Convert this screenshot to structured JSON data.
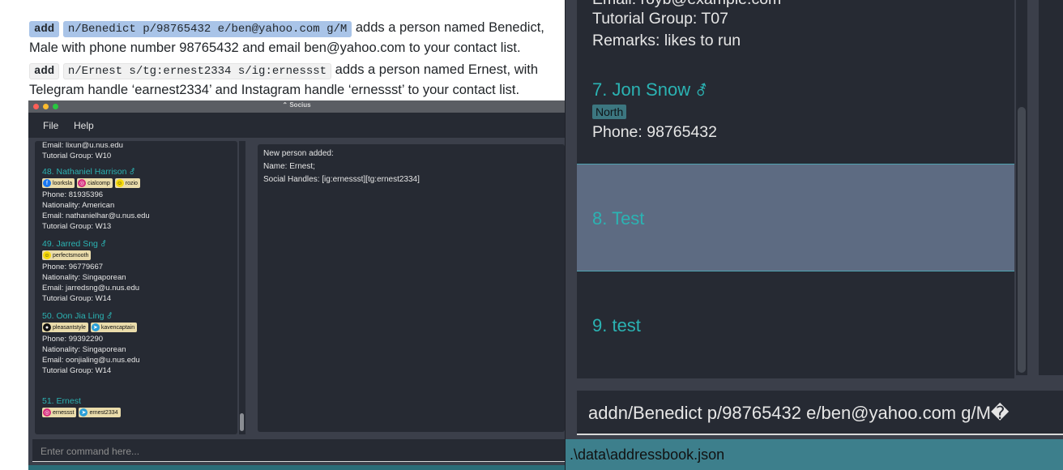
{
  "doc": {
    "item1": {
      "code_prefix": "add",
      "code_args": "n/Benedict p/98765432 e/ben@yahoo.com g/M",
      "line1": "adds a person named Benedict,",
      "line2": "Male with phone number 98765432 and email ben@yahoo.com to your contact list."
    },
    "item2": {
      "code_prefix": "add",
      "code_args": "n/Ernest s/tg:ernest2334 s/ig:ernessst",
      "line1": "adds a person named Ernest, with",
      "line2": "Telegram handle ‘earnest2334’ and Instagram handle ‘ernessst’ to your contact list."
    }
  },
  "small_window": {
    "title": "Socius",
    "menu": [
      "File",
      "Help"
    ],
    "list": {
      "top_email": "Email: lixun@u.nus.edu",
      "top_group": "Tutorial Group: W10",
      "persons": [
        {
          "name": "48.  Nathaniel Harrison",
          "tags": [
            {
              "icon": "facebook-icon",
              "label": "loorksla",
              "color": "#1877f2"
            },
            {
              "icon": "instagram-icon",
              "label": "cialcomp",
              "color": "#d6297b"
            },
            {
              "icon": "snapchat-icon",
              "label": "rozio",
              "color": "#f5d90a"
            }
          ],
          "phone": "Phone: 81935396",
          "nationality": "Nationality: American",
          "email": "Email: nathanielhar@u.nus.edu",
          "group": "Tutorial Group: W13"
        },
        {
          "name": "49.  Jarred Sng",
          "tags": [
            {
              "icon": "snapchat-icon",
              "label": "perfectsmooth",
              "color": "#f5d90a"
            }
          ],
          "phone": "Phone: 96779667",
          "nationality": "Nationality: Singaporean",
          "email": "Email: jarredsng@u.nus.edu",
          "group": "Tutorial Group: W14"
        },
        {
          "name": "50.  Oon Jia Ling",
          "tags": [
            {
              "icon": "github-icon",
              "label": "pleasantstyle",
              "color": "#111111"
            },
            {
              "icon": "telegram-icon",
              "label": "kavencaptain",
              "color": "#2a9fd8"
            }
          ],
          "phone": "Phone: 99392290",
          "nationality": "Nationality: Singaporean",
          "email": "Email: oonjialing@u.nus.edu",
          "group": "Tutorial Group: W14"
        },
        {
          "name": "51.  Ernest",
          "tags": [
            {
              "icon": "instagram-icon",
              "label": "ernessst",
              "color": "#d6297b"
            },
            {
              "icon": "telegram-icon",
              "label": "ernest2334",
              "color": "#2a9fd8"
            }
          ]
        }
      ]
    },
    "result": [
      "New person added:",
      "Name: Ernest;",
      "Social Handles: [ig:ernessst][tg:ernest2334]"
    ],
    "command_placeholder": "Enter command here..."
  },
  "big_window": {
    "top_email": "Email: royb@example.com",
    "top_group": "Tutorial Group: T07",
    "top_remarks": "Remarks: likes to run",
    "person7": {
      "name": "7.  Jon Snow",
      "tag": "North",
      "phone": "Phone: 98765432"
    },
    "person8": {
      "name": "8.  Test"
    },
    "person9": {
      "name": "9.  test"
    },
    "command_value": "addn/Benedict p/98765432 e/ben@yahoo.com g/M�",
    "status": ".\\data\\addressbook.json"
  },
  "colors": {
    "accent": "#2bb3b3",
    "panel": "#262a33",
    "background": "#3b3f4a",
    "status_bar": "#3d7f8c",
    "selected_row": "#5d6b82"
  }
}
